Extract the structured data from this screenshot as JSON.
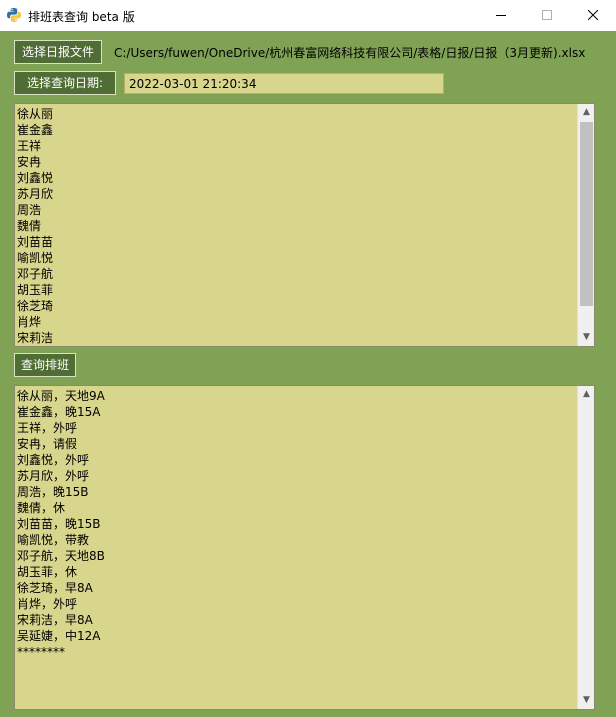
{
  "window": {
    "title": "排班表查询 beta 版"
  },
  "file": {
    "button_label": "选择日报文件",
    "path": "C:/Users/fuwen/OneDrive/杭州春富网络科技有限公司/表格/日报/日报（3月更新).xlsx"
  },
  "date": {
    "button_label": "选择查询日期:",
    "value": "2022-03-01 21:20:34"
  },
  "names_list": {
    "items": [
      "徐从丽",
      "崔金鑫",
      "王祥",
      "安冉",
      "刘鑫悦",
      "苏月欣",
      "周浩",
      "魏倩",
      "刘苗苗",
      "喻凯悦",
      "邓子航",
      "胡玉菲",
      "徐芝琦",
      "肖烨",
      "宋莉洁"
    ]
  },
  "query": {
    "button_label": "查询排班"
  },
  "results": {
    "items": [
      "徐从丽，天地9A",
      "崔金鑫，晚15A",
      "王祥，外呼",
      "安冉，请假",
      "刘鑫悦，外呼",
      "苏月欣，外呼",
      "周浩，晚15B",
      "魏倩，休",
      "刘苗苗，晚15B",
      "喻凯悦，带教",
      "邓子航，天地8B",
      "胡玉菲，休",
      "徐芝琦，早8A",
      "肖烨，外呼",
      "宋莉洁，早8A",
      "吴延婕，中12A",
      "********"
    ]
  },
  "icons": {
    "app": "python-icon",
    "minimize": "minimize-icon",
    "maximize": "maximize-icon",
    "close": "close-icon"
  },
  "colors": {
    "window_background": "#80a255",
    "button_background": "#4f6d35",
    "field_background": "#d8d58d"
  }
}
